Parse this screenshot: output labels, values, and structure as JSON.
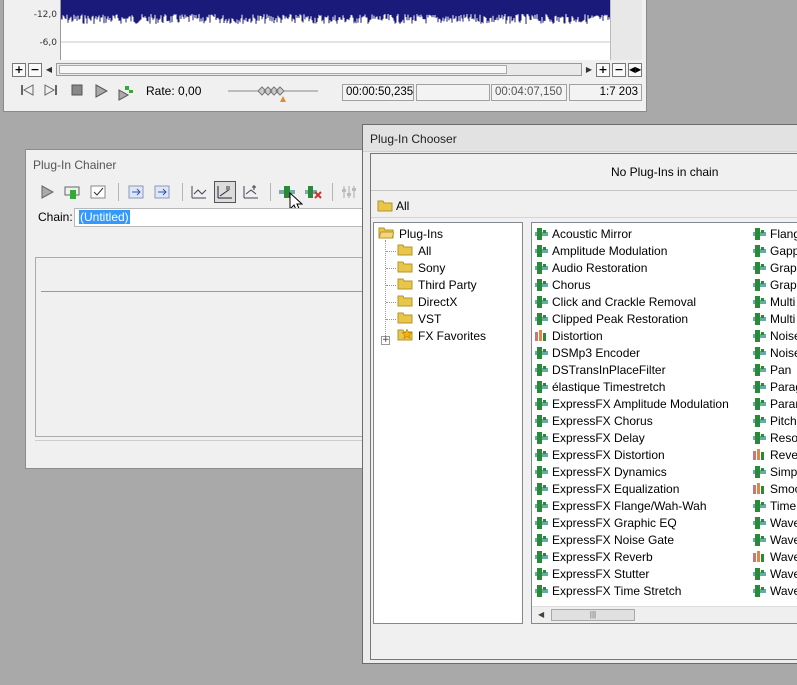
{
  "editor": {
    "db_labels": [
      "-12,0",
      "-6,0"
    ],
    "rate_label": "Rate: 0,00",
    "cursor_time": "00:00:50,235",
    "selection_time": "",
    "length_time": "00:04:07,150",
    "zoom_ratio": "1:7 203",
    "zoom_in": "+",
    "zoom_out": "−"
  },
  "chainer": {
    "title": "Plug-In Chainer",
    "chain_label": "Chain:",
    "chain_value": "(Untitled)"
  },
  "chooser": {
    "title": "Plug-In Chooser",
    "status": "No Plug-Ins in chain",
    "path": "All",
    "tree": {
      "root": "Plug-Ins",
      "children": [
        "All",
        "Sony",
        "Third Party",
        "DirectX",
        "VST"
      ],
      "favorites": "FX Favorites"
    },
    "plugins_col1": [
      "Acoustic Mirror",
      "Amplitude Modulation",
      "Audio Restoration",
      "Chorus",
      "Click and Crackle Removal",
      "Clipped Peak Restoration",
      "Distortion",
      "DSMp3 Encoder",
      "DSTransInPlaceFilter",
      "élastique Timestretch",
      "ExpressFX Amplitude Modulation",
      "ExpressFX Chorus",
      "ExpressFX Delay",
      "ExpressFX Distortion",
      "ExpressFX Dynamics",
      "ExpressFX Equalization",
      "ExpressFX Flange/Wah-Wah",
      "ExpressFX Graphic EQ",
      "ExpressFX Noise Gate",
      "ExpressFX Reverb",
      "ExpressFX Stutter",
      "ExpressFX Time Stretch"
    ],
    "plugins_col2": [
      "Flang",
      "Gapp",
      "Graph",
      "Graph",
      "Multi",
      "Multi",
      "Noise",
      "Noise",
      "Pan",
      "Parag",
      "Param",
      "Pitch",
      "Resor",
      "Rever",
      "Simpl",
      "Smoc",
      "Time",
      "Wave",
      "Wave",
      "Wave",
      "Wave",
      "Wave"
    ]
  }
}
